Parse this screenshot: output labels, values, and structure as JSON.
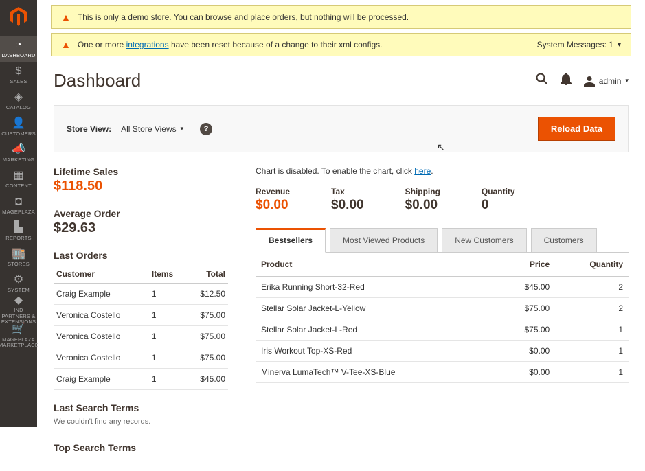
{
  "sidebar": {
    "items": [
      {
        "label": "DASHBOARD",
        "icon": "◔"
      },
      {
        "label": "SALES",
        "icon": "$"
      },
      {
        "label": "CATALOG",
        "icon": "◈"
      },
      {
        "label": "CUSTOMERS",
        "icon": "👤"
      },
      {
        "label": "MARKETING",
        "icon": "📣"
      },
      {
        "label": "CONTENT",
        "icon": "▦"
      },
      {
        "label": "MAGEPLAZA",
        "icon": "◘"
      },
      {
        "label": "REPORTS",
        "icon": "▙"
      },
      {
        "label": "STORES",
        "icon": "🏬"
      },
      {
        "label": "SYSTEM",
        "icon": "⚙"
      },
      {
        "label": "IND PARTNERS & EXTENSIONS",
        "icon": "◆"
      },
      {
        "label": "MAGEPLAZA MARKETPLACE",
        "icon": "🛒"
      }
    ]
  },
  "notices": {
    "demo": "This is only a demo store. You can browse and place orders, but nothing will be processed.",
    "integrations_pre": "One or more ",
    "integrations_link": "integrations",
    "integrations_post": " have been reset because of a change to their xml configs.",
    "sysmsg_label": "System Messages:",
    "sysmsg_count": "1"
  },
  "header": {
    "title": "Dashboard",
    "user": "admin"
  },
  "storeview": {
    "label": "Store View:",
    "selected": "All Store Views",
    "reload": "Reload Data"
  },
  "stats": {
    "lifetime_label": "Lifetime Sales",
    "lifetime_value": "$118.50",
    "avg_label": "Average Order",
    "avg_value": "$29.63"
  },
  "last_orders": {
    "title": "Last Orders",
    "cols": {
      "customer": "Customer",
      "items": "Items",
      "total": "Total"
    },
    "rows": [
      {
        "customer": "Craig Example",
        "items": "1",
        "total": "$12.50"
      },
      {
        "customer": "Veronica Costello",
        "items": "1",
        "total": "$75.00"
      },
      {
        "customer": "Veronica Costello",
        "items": "1",
        "total": "$75.00"
      },
      {
        "customer": "Veronica Costello",
        "items": "1",
        "total": "$75.00"
      },
      {
        "customer": "Craig Example",
        "items": "1",
        "total": "$45.00"
      }
    ]
  },
  "search": {
    "last_title": "Last Search Terms",
    "last_empty": "We couldn't find any records.",
    "top_title": "Top Search Terms"
  },
  "chart": {
    "note_pre": "Chart is disabled. To enable the chart, click ",
    "note_link": "here",
    "note_post": "."
  },
  "summary": {
    "revenue_label": "Revenue",
    "revenue_value": "$0.00",
    "tax_label": "Tax",
    "tax_value": "$0.00",
    "shipping_label": "Shipping",
    "shipping_value": "$0.00",
    "qty_label": "Quantity",
    "qty_value": "0"
  },
  "tabs": {
    "bestsellers": "Bestsellers",
    "mostviewed": "Most Viewed Products",
    "newcust": "New Customers",
    "customers": "Customers"
  },
  "products": {
    "cols": {
      "product": "Product",
      "price": "Price",
      "qty": "Quantity"
    },
    "rows": [
      {
        "product": "Erika Running Short-32-Red",
        "price": "$45.00",
        "qty": "2"
      },
      {
        "product": "Stellar Solar Jacket-L-Yellow",
        "price": "$75.00",
        "qty": "2"
      },
      {
        "product": "Stellar Solar Jacket-L-Red",
        "price": "$75.00",
        "qty": "1"
      },
      {
        "product": "Iris Workout Top-XS-Red",
        "price": "$0.00",
        "qty": "1"
      },
      {
        "product": "Minerva LumaTech™ V-Tee-XS-Blue",
        "price": "$0.00",
        "qty": "1"
      }
    ]
  }
}
